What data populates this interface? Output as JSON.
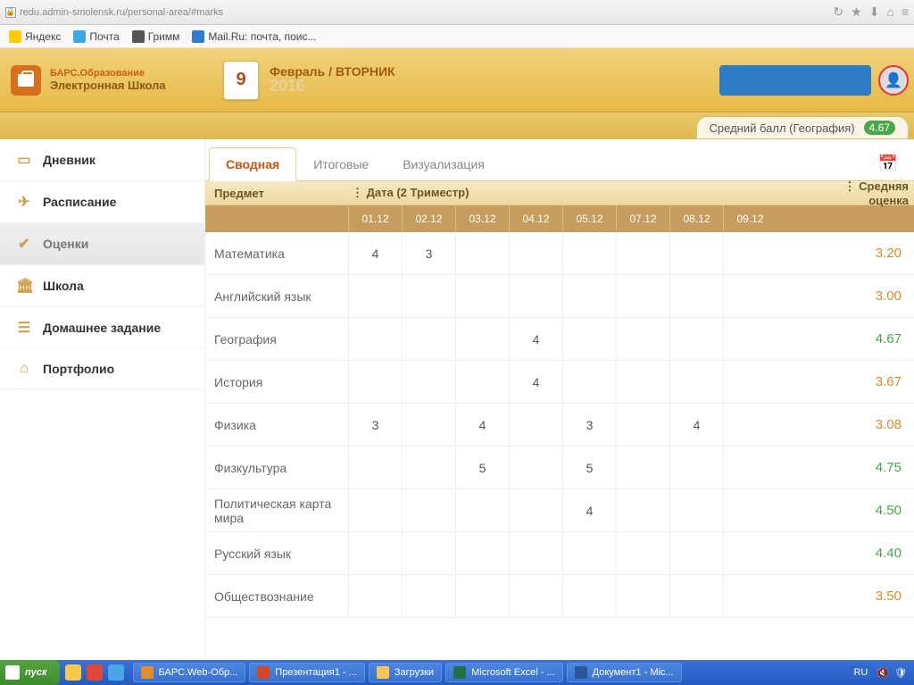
{
  "browser": {
    "url": "redu.admin-smolensk.ru/personal-area/#marks",
    "icons": [
      "↻",
      "★",
      "⬇",
      "⌂",
      "≡"
    ]
  },
  "bookmarks": [
    {
      "label": "Яндекс"
    },
    {
      "label": "Почта"
    },
    {
      "label": "Гримм"
    },
    {
      "label": "Mail.Ru: почта, поис..."
    }
  ],
  "logo": {
    "line1": "БАРС.Образование",
    "line2": "Электронная Школа"
  },
  "date": {
    "num": "9",
    "day": "Февраль / ВТОРНИК",
    "year": "2016"
  },
  "avg_tab": {
    "label": "Средний балл (География)",
    "value": "4.67"
  },
  "sidebar": [
    {
      "icon": "▭",
      "label": "Дневник"
    },
    {
      "icon": "✈",
      "label": "Расписание"
    },
    {
      "icon": "✔",
      "label": "Оценки",
      "active": true
    },
    {
      "icon": "🏛",
      "label": "Школа"
    },
    {
      "icon": "☰",
      "label": "Домашнее задание"
    },
    {
      "icon": "⌂",
      "label": "Портфолио"
    }
  ],
  "view_tabs": [
    {
      "label": "Сводная",
      "active": true
    },
    {
      "label": "Итоговые"
    },
    {
      "label": "Визуализация"
    }
  ],
  "grades_header": {
    "subject": "Предмет",
    "dates": "Дата (2 Триместр)",
    "avg": "Средняя оценка"
  },
  "date_columns": [
    "01.12",
    "02.12",
    "03.12",
    "04.12",
    "05.12",
    "07.12",
    "08.12",
    "09.12"
  ],
  "rows": [
    {
      "subject": "Математика",
      "cells": [
        "4",
        "3",
        "",
        "",
        "",
        "",
        "",
        ""
      ],
      "avg": "3.20",
      "cls": "orange"
    },
    {
      "subject": "Английский язык",
      "cells": [
        "",
        "",
        "",
        "",
        "",
        "",
        "",
        ""
      ],
      "avg": "3.00",
      "cls": "orange"
    },
    {
      "subject": "География",
      "cells": [
        "",
        "",
        "",
        "4",
        "",
        "",
        "",
        ""
      ],
      "avg": "4.67",
      "cls": "green"
    },
    {
      "subject": "История",
      "cells": [
        "",
        "",
        "",
        "4",
        "",
        "",
        "",
        ""
      ],
      "avg": "3.67",
      "cls": "orange"
    },
    {
      "subject": "Физика",
      "cells": [
        "3",
        "",
        "4",
        "",
        "3",
        "",
        "4",
        ""
      ],
      "avg": "3.08",
      "cls": "orange"
    },
    {
      "subject": "Физкультура",
      "cells": [
        "",
        "",
        "5",
        "",
        "5",
        "",
        "",
        ""
      ],
      "avg": "4.75",
      "cls": "green"
    },
    {
      "subject": "Политическая карта мира",
      "cells": [
        "",
        "",
        "",
        "",
        "4",
        "",
        "",
        ""
      ],
      "avg": "4.50",
      "cls": "green"
    },
    {
      "subject": "Русский язык",
      "cells": [
        "",
        "",
        "",
        "",
        "",
        "",
        "",
        ""
      ],
      "avg": "4.40",
      "cls": "green"
    },
    {
      "subject": "Обществознание",
      "cells": [
        "",
        "",
        "",
        "",
        "",
        "",
        "",
        ""
      ],
      "avg": "3.50",
      "cls": "orange"
    }
  ],
  "taskbar": {
    "start": "пуск",
    "tasks": [
      {
        "cls": "t-ff",
        "label": "БАРС.Web-Обр..."
      },
      {
        "cls": "t-pp",
        "label": "Презентация1 - ..."
      },
      {
        "cls": "t-fld",
        "label": "Загрузки"
      },
      {
        "cls": "t-xl",
        "label": "Microsoft Excel - ..."
      },
      {
        "cls": "t-wd",
        "label": "Документ1 - Mic..."
      }
    ],
    "lang": "RU"
  }
}
